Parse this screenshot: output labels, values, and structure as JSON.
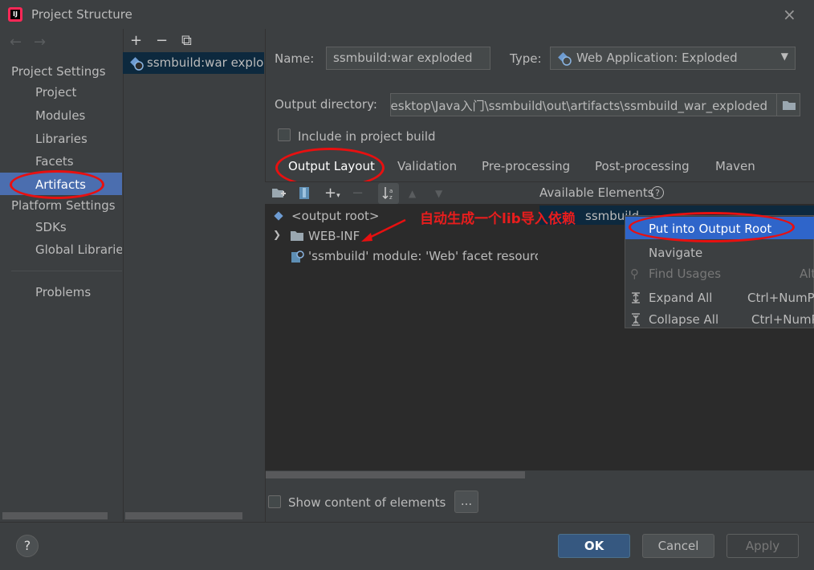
{
  "window": {
    "title": "Project Structure",
    "close_icon": "×"
  },
  "nav": {
    "back_icon": "←",
    "forward_icon": "→",
    "project_settings_header": "Project Settings",
    "project_items": [
      "Project",
      "Modules",
      "Libraries",
      "Facets",
      "Artifacts"
    ],
    "platform_settings_header": "Platform Settings",
    "platform_items": [
      "SDKs",
      "Global Libraries"
    ],
    "problems": "Problems",
    "selected": "Artifacts"
  },
  "artifact_list": {
    "add_icon": "+",
    "remove_icon": "−",
    "copy_icon": "⧉",
    "items": [
      "ssmbuild:war exploded"
    ]
  },
  "form": {
    "name_label": "Name:",
    "name_value": "ssmbuild:war exploded",
    "type_label": "Type:",
    "type_value": "Web Application: Exploded",
    "output_dir_label": "Output directory:",
    "output_dir_value": "Desktop\\Java入门\\ssmbuild\\out\\artifacts\\ssmbuild_war_exploded",
    "include_label": "Include in project build",
    "include_checked": false
  },
  "tabs": [
    "Output Layout",
    "Validation",
    "Pre-processing",
    "Post-processing",
    "Maven"
  ],
  "active_tab": "Output Layout",
  "layout": {
    "available_label": "Available Elements",
    "tree": [
      "<output root>",
      "WEB-INF",
      "'ssmbuild' module: 'Web' facet resource"
    ],
    "available_item": "ssmbuild",
    "annotation": "自动生成一个lib导入依赖"
  },
  "context_menu": {
    "items": [
      {
        "label": "Put into Output Root",
        "shortcut": ""
      },
      {
        "label": "Navigate",
        "shortcut": ""
      },
      {
        "label": "Find Usages",
        "shortcut": "Alt"
      },
      {
        "label": "Expand All",
        "shortcut": "Ctrl+NumPa"
      },
      {
        "label": "Collapse All",
        "shortcut": "Ctrl+NumP"
      }
    ]
  },
  "show_content_label": "Show content of elements",
  "ellipsis_label": "...",
  "buttons": {
    "ok": "OK",
    "cancel": "Cancel",
    "apply": "Apply",
    "help": "?"
  },
  "colors": {
    "selection": "#4b6eaf",
    "menu_selection": "#2f65ca",
    "annotation_red": "#e81010"
  }
}
